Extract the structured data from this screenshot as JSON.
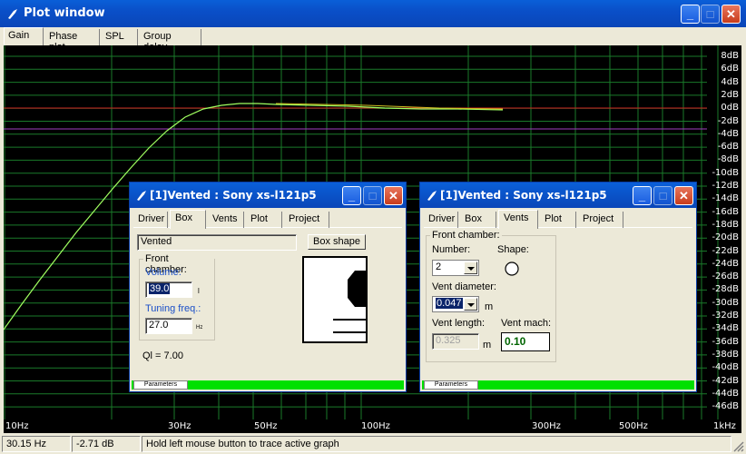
{
  "window": {
    "title": "Plot window"
  },
  "tabs": [
    "Gain",
    "Phase plot",
    "SPL",
    "Group delay"
  ],
  "plot": {
    "y_ticks": [
      "8dB",
      "6dB",
      "4dB",
      "2dB",
      "0dB",
      "-2dB",
      "-4dB",
      "-6dB",
      "-8dB",
      "-10dB",
      "-12dB",
      "-14dB",
      "-16dB",
      "-18dB",
      "-20dB",
      "-22dB",
      "-24dB",
      "-26dB",
      "-28dB",
      "-30dB",
      "-32dB",
      "-34dB",
      "-36dB",
      "-38dB",
      "-40dB",
      "-42dB",
      "-44dB",
      "-46dB"
    ],
    "x_ticks": [
      "10Hz",
      "30Hz",
      "50Hz",
      "100Hz",
      "300Hz",
      "500Hz",
      "1kHz"
    ],
    "colors": {
      "background": "#000000",
      "grid": "#1a7a2a",
      "curve": "#a0ff60",
      "ref_red": "#d02020",
      "ref_purple": "#a040c0"
    }
  },
  "status": {
    "freq": "30.15 Hz",
    "gain": "-2.71 dB",
    "hint": "Hold left mouse button to trace active graph"
  },
  "dialog_box": {
    "title": "[1]Vented : Sony xs-l121p5",
    "tabs": [
      "Driver",
      "Box",
      "Vents",
      "Plot",
      "Project"
    ],
    "box_type": "Vented",
    "box_shape_button": "Box shape",
    "front_chamber_label": "Front chamber:",
    "volume_label": "Volume:",
    "volume_value": "39.0",
    "volume_unit": "l",
    "tuning_label": "Tuning freq.:",
    "tuning_value": "27.0",
    "tuning_unit": "Hz",
    "ql": "Ql = 7.00",
    "status_tab": "Parameters"
  },
  "dialog_vents": {
    "title": "[1]Vented : Sony xs-l121p5",
    "tabs": [
      "Driver",
      "Box",
      "Vents",
      "Plot",
      "Project"
    ],
    "front_chamber_label": "Front chamber:",
    "number_label": "Number:",
    "number_value": "2",
    "shape_label": "Shape:",
    "diameter_label": "Vent diameter:",
    "diameter_value": "0.047",
    "diameter_unit": "m",
    "length_label": "Vent length:",
    "length_value": "0.325",
    "length_unit": "m",
    "mach_label": "Vent mach:",
    "mach_value": "0.10",
    "status_tab": "Parameters"
  }
}
